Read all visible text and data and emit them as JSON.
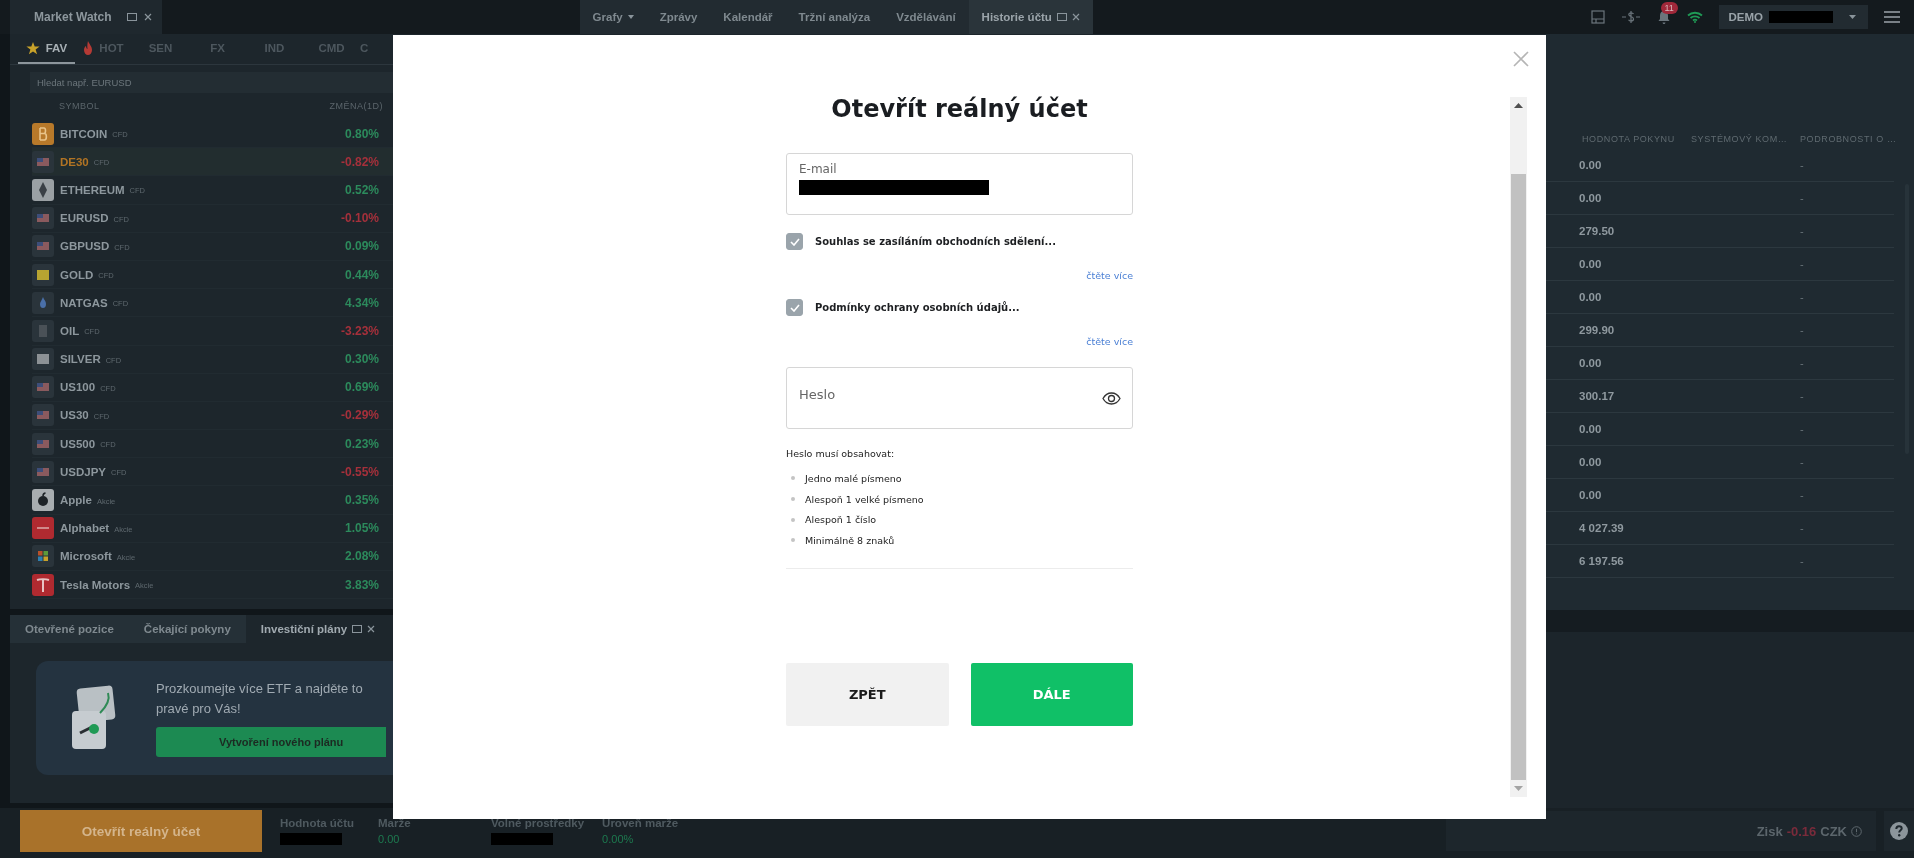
{
  "top_bar": {
    "panel_tab": {
      "label": "Market Watch"
    },
    "tabs": [
      {
        "label": "Grafy",
        "dropdown": true,
        "selected": false
      },
      {
        "label": "Zprávy",
        "dropdown": false,
        "selected": false
      },
      {
        "label": "Kalendář",
        "dropdown": false,
        "selected": false
      },
      {
        "label": "Tržní analýza",
        "dropdown": false,
        "selected": false
      },
      {
        "label": "Vzdělávání",
        "dropdown": false,
        "selected": false
      },
      {
        "label": "Historie účtu",
        "dropdown": false,
        "selected": true
      }
    ],
    "notifications": "11",
    "account_mode": "DEMO"
  },
  "market_watch": {
    "tabs": [
      {
        "label": "FAV",
        "selected": true
      },
      {
        "label": "HOT",
        "selected": false
      },
      {
        "label": "SEN",
        "selected": false
      },
      {
        "label": "FX",
        "selected": false
      },
      {
        "label": "IND",
        "selected": false
      },
      {
        "label": "CMD",
        "selected": false
      },
      {
        "label": "C",
        "selected": false
      }
    ],
    "search": {
      "placeholder": "Hledat např. EURUSD"
    },
    "columns": [
      "SYMBOL",
      "ZMĚNA(1D)"
    ],
    "rows": [
      {
        "name": "BITCOIN",
        "type": "CFD",
        "change": "0.80%",
        "color": "#2c8a5c",
        "selected": false
      },
      {
        "name": "DE30",
        "type": "CFD",
        "change": "-0.82%",
        "color": "#a5303b",
        "selected": true
      },
      {
        "name": "ETHEREUM",
        "type": "CFD",
        "change": "0.52%",
        "color": "#2c8a5c",
        "selected": false
      },
      {
        "name": "EURUSD",
        "type": "CFD",
        "change": "-0.10%",
        "color": "#a5303b",
        "selected": false
      },
      {
        "name": "GBPUSD",
        "type": "CFD",
        "change": "0.09%",
        "color": "#2c8a5c",
        "selected": false
      },
      {
        "name": "GOLD",
        "type": "CFD",
        "change": "0.44%",
        "color": "#2c8a5c",
        "selected": false
      },
      {
        "name": "NATGAS",
        "type": "CFD",
        "change": "4.34%",
        "color": "#2c8a5c",
        "selected": false
      },
      {
        "name": "OIL",
        "type": "CFD",
        "change": "-3.23%",
        "color": "#a5303b",
        "selected": false
      },
      {
        "name": "SILVER",
        "type": "CFD",
        "change": "0.30%",
        "color": "#2c8a5c",
        "selected": false
      },
      {
        "name": "US100",
        "type": "CFD",
        "change": "0.69%",
        "color": "#2c8a5c",
        "selected": false
      },
      {
        "name": "US30",
        "type": "CFD",
        "change": "-0.29%",
        "color": "#a5303b",
        "selected": false
      },
      {
        "name": "US500",
        "type": "CFD",
        "change": "0.23%",
        "color": "#2c8a5c",
        "selected": false
      },
      {
        "name": "USDJPY",
        "type": "CFD",
        "change": "-0.55%",
        "color": "#a5303b",
        "selected": false
      },
      {
        "name": "Apple",
        "type": "Akcie",
        "change": "0.35%",
        "color": "#2c8a5c",
        "selected": false
      },
      {
        "name": "Alphabet",
        "type": "Akcie",
        "change": "1.05%",
        "color": "#2c8a5c",
        "selected": false
      },
      {
        "name": "Microsoft",
        "type": "Akcie",
        "change": "2.08%",
        "color": "#2c8a5c",
        "selected": false
      },
      {
        "name": "Tesla Motors",
        "type": "Akcie",
        "change": "3.83%",
        "color": "#2c8a5c",
        "selected": false
      }
    ]
  },
  "bottom_panel": {
    "tabs": [
      {
        "label": "Otevřené pozice",
        "selected": false
      },
      {
        "label": "Čekající pokyny",
        "selected": false
      },
      {
        "label": "Investiční plány",
        "selected": true
      }
    ],
    "promo": {
      "text": "Prozkoumejte více ETF a najděte to",
      "text_2": "pravé pro Vás!",
      "button": "Vytvoření nového plánu"
    }
  },
  "orders_table": {
    "columns": [
      "HODNOTA POKYNU",
      "SYSTÉMOVÝ KOM…",
      "PODROBNOSTI O …"
    ],
    "rows": [
      [
        "0.00",
        "-"
      ],
      [
        "0.00",
        "-"
      ],
      [
        "279.50",
        "-"
      ],
      [
        "0.00",
        "-"
      ],
      [
        "0.00",
        "-"
      ],
      [
        "299.90",
        "-"
      ],
      [
        "0.00",
        "-"
      ],
      [
        "300.17",
        "-"
      ],
      [
        "0.00",
        "-"
      ],
      [
        "0.00",
        "-"
      ],
      [
        "0.00",
        "-"
      ],
      [
        "4 027.39",
        "-"
      ],
      [
        "6 197.56",
        "-"
      ]
    ]
  },
  "status_bar": {
    "open_account_button": "Otevřít reálný účet",
    "stats": [
      {
        "label": "Hodnota účtu",
        "redacted": true
      },
      {
        "label": "Marže",
        "value": "0.00",
        "redacted": false
      },
      {
        "label": "Volné prostředky",
        "redacted": true
      },
      {
        "label": "Úroveň marže",
        "value": "0.00%",
        "redacted": false
      }
    ],
    "profit": {
      "label": "Zisk",
      "value": "-0.16",
      "currency": "CZK"
    }
  },
  "modal": {
    "title": "Otevřít reálný účet",
    "email": {
      "label": "E-mail",
      "redacted": true
    },
    "consents": [
      {
        "label": "Souhlas se zasíláním obchodních sdělení...",
        "checked": true,
        "link": "čtěte více"
      },
      {
        "label": "Podmínky ochrany osobních údajů...",
        "checked": true,
        "link": "čtěte více"
      }
    ],
    "password": {
      "placeholder": "Heslo"
    },
    "requirements": {
      "heading": "Heslo musí obsahovat:",
      "items": [
        "Jedno malé písmeno",
        "Alespoň 1 velké písmeno",
        "Alespoň 1 číslo",
        "Minimálně 8 znaků"
      ]
    },
    "buttons": [
      {
        "label": "ZPĚT",
        "kind": "secondary"
      },
      {
        "label": "DÁLE",
        "kind": "primary"
      }
    ]
  }
}
